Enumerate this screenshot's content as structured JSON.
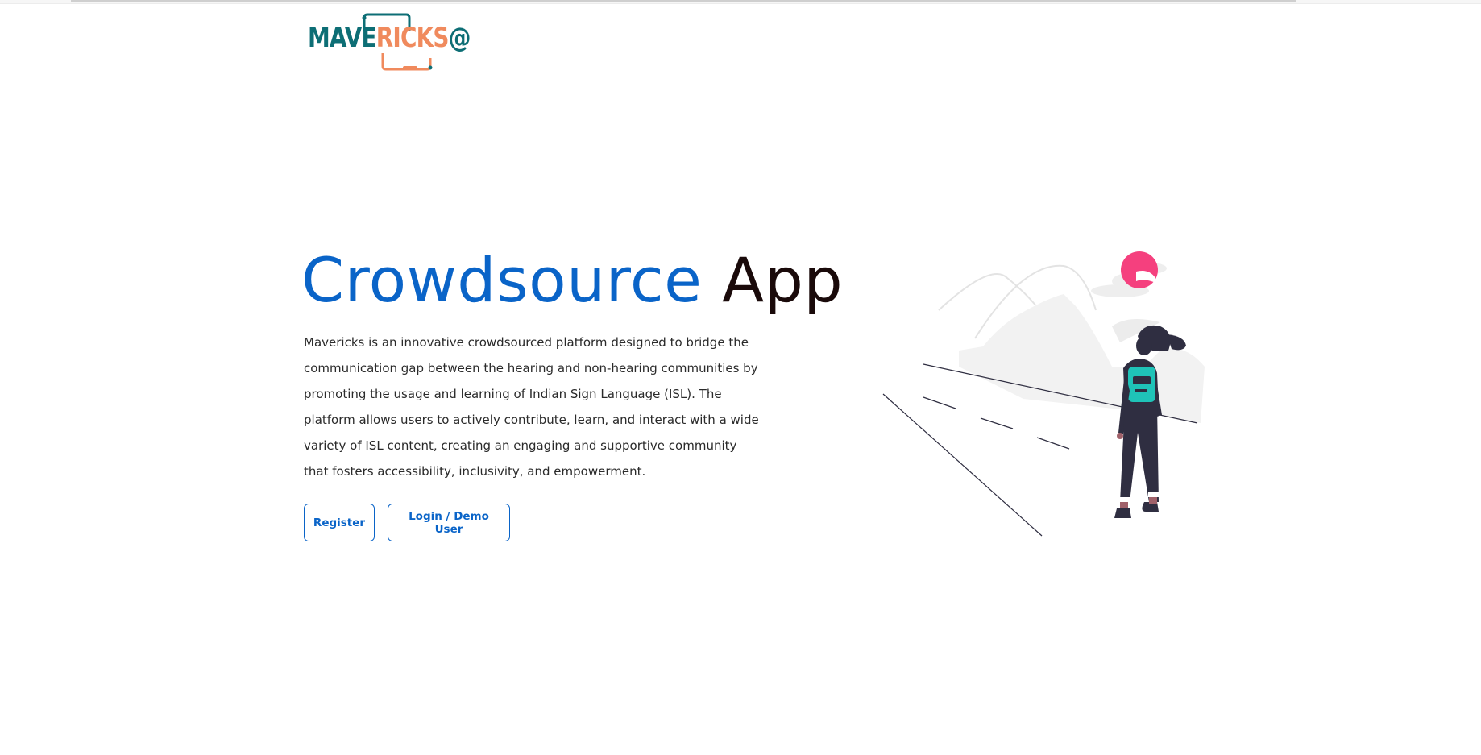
{
  "logo": {
    "part1": "MAVE",
    "part2": "RICKS",
    "part3": "@",
    "colors": {
      "teal": "#0d6e75",
      "orange": "#f08a5d"
    }
  },
  "hero": {
    "title_part1": "Crowdsource",
    "title_part2": "App",
    "title_colors": {
      "part1": "#0a64c8",
      "part2": "#1a0a0a"
    },
    "description": "Mavericks is an innovative crowdsourced platform designed to bridge the communication gap between the hearing and non-hearing communities by promoting the usage and learning of Indian Sign Language (ISL). The platform allows users to actively contribute, learn, and interact with a wide variety of ISL content, creating an engaging and supportive community that fosters accessibility, inclusivity, and empowerment."
  },
  "actions": {
    "register_label": "Register",
    "login_label": "Login / Demo User",
    "accent": "#0a64c8"
  },
  "illustration": {
    "name": "woman-looking-at-mountains-illustration",
    "accent_colors": {
      "sun": "#f5407e",
      "backpack": "#1fc3b8",
      "figure": "#2f2e41"
    }
  }
}
